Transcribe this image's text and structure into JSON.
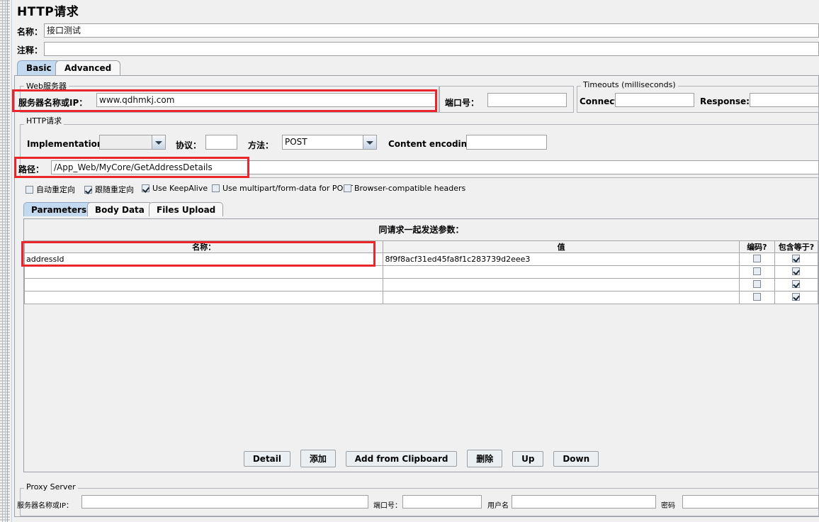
{
  "window": {
    "title": "HTTP请求"
  },
  "header": {
    "name_label": "名称：",
    "name_value": "接口测试",
    "comment_label": "注释：",
    "comment_value": ""
  },
  "tabs": [
    {
      "label": "Basic",
      "active": true
    },
    {
      "label": "Advanced",
      "active": false
    }
  ],
  "web_server": {
    "group_title": "Web服务器",
    "host_label": "服务器名称或IP：",
    "host_value": "www.qdhmkj.com",
    "port_label": "端口号：",
    "port_value": ""
  },
  "timeouts": {
    "group_title": "Timeouts (milliseconds)",
    "connect_label": "Connect:",
    "connect_value": "",
    "response_label": "Response:",
    "response_value": ""
  },
  "http_request": {
    "group_title": "HTTP请求",
    "implementation_label": "Implementation:",
    "implementation_value": "",
    "protocol_label": "协议：",
    "protocol_value": "",
    "method_label": "方法：",
    "method_value": "POST",
    "content_encoding_label": "Content encoding:",
    "content_encoding_value": "",
    "path_label": "路径：",
    "path_value": "/App_Web/MyCore/GetAddressDetails",
    "options": [
      {
        "label": "自动重定向",
        "checked": false
      },
      {
        "label": "跟随重定向",
        "checked": true
      },
      {
        "label": "Use KeepAlive",
        "checked": true
      },
      {
        "label": "Use multipart/form-data for POST",
        "checked": false
      },
      {
        "label": "Browser-compatible headers",
        "checked": false
      }
    ]
  },
  "inner_tabs": [
    {
      "label": "Parameters",
      "active": true
    },
    {
      "label": "Body Data",
      "active": false
    },
    {
      "label": "Files Upload",
      "active": false
    }
  ],
  "parameters": {
    "section_title": "同请求一起发送参数：",
    "columns": [
      "名称：",
      "值",
      "编码?",
      "包含等于?"
    ],
    "rows": [
      {
        "name": "addressId",
        "value": "8f9f8acf31ed45fa8f1c283739d2eee3",
        "encode": false,
        "include_equals": true
      },
      {
        "name": "",
        "value": "",
        "encode": false,
        "include_equals": true
      },
      {
        "name": "",
        "value": "",
        "encode": false,
        "include_equals": true
      },
      {
        "name": "",
        "value": "",
        "encode": false,
        "include_equals": true
      }
    ],
    "buttons": [
      "Detail",
      "添加",
      "Add from Clipboard",
      "删除",
      "Up",
      "Down"
    ]
  },
  "proxy_server": {
    "group_title": "Proxy Server",
    "host_label": "服务器名称或IP：",
    "host_value": "",
    "port_label": "端口号：",
    "port_value": "",
    "username_label": "用户名",
    "username_value": "",
    "password_label": "密码",
    "password_value": ""
  },
  "highlight_color": "#e8262b"
}
